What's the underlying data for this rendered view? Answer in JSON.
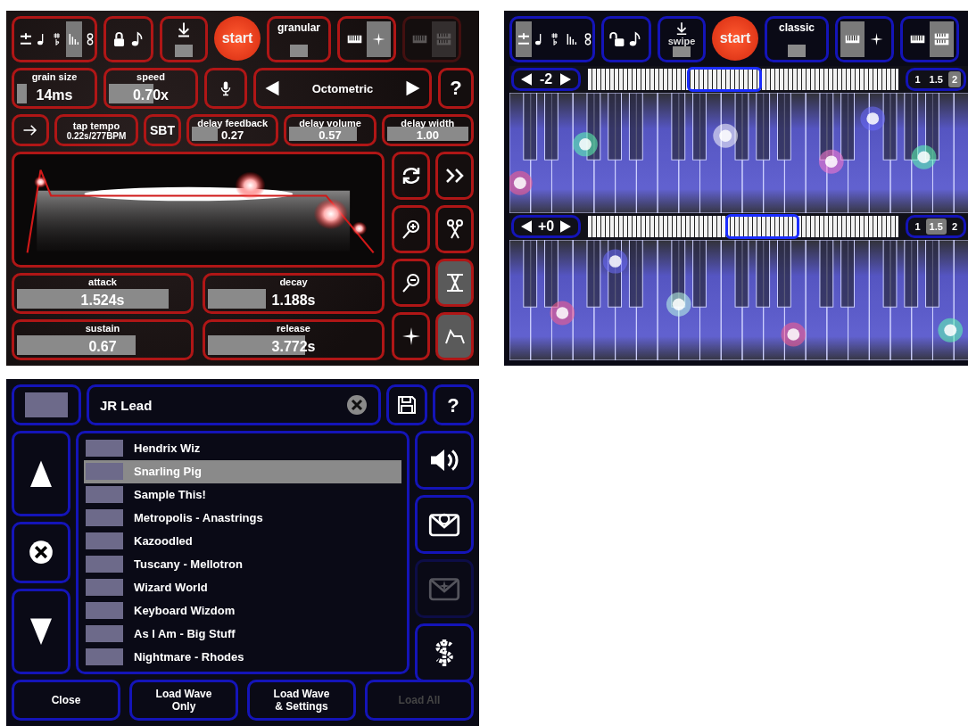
{
  "synth_panel": {
    "toolbar": {
      "tuning_tools": [
        {
          "selected": false
        },
        {
          "selected": false
        },
        {
          "selected": false
        },
        {
          "selected": true
        },
        {
          "selected": false
        }
      ],
      "locked": true,
      "swipe": {
        "on": true
      },
      "start": "start",
      "mode": {
        "label": "granular",
        "on": true
      },
      "views": [
        {
          "selected": false
        },
        {
          "selected": true
        }
      ],
      "layouts": [
        {
          "selected": false
        },
        {
          "selected": true
        }
      ],
      "layout_disabled": true
    },
    "top_sliders": [
      {
        "label": "grain size",
        "value": "14ms",
        "level": 0.12
      },
      {
        "label": "speed",
        "value": "0.70x",
        "level": 0.5
      }
    ],
    "scale": "Octometric",
    "help": "?",
    "tap_tempo": {
      "label": "tap tempo",
      "value": "0.22s/277BPM"
    },
    "sbt": "SBT",
    "delay_sliders": [
      {
        "label": "delay feedback",
        "value": "0.27",
        "level": 0.3
      },
      {
        "label": "delay volume",
        "value": "0.57",
        "level": 0.78
      },
      {
        "label": "delay width",
        "value": "1.00",
        "level": 1
      }
    ],
    "envelope_sliders": [
      {
        "label": "attack",
        "value": "1.524s",
        "level": 0.86
      },
      {
        "label": "decay",
        "value": "1.188s",
        "level": 0.33
      },
      {
        "label": "sustain",
        "value": "0.67",
        "level": 0.67
      },
      {
        "label": "release",
        "value": "3.772s",
        "level": 0.55
      }
    ],
    "side_tools": [
      {
        "selected": false
      },
      {
        "selected": false
      },
      {
        "selected": false
      },
      {
        "selected": false
      },
      {
        "selected": false
      },
      {
        "selected": true
      },
      {
        "selected": false
      },
      {
        "selected": true
      }
    ]
  },
  "keyboard_panel": {
    "toolbar": {
      "tuning_tools": [
        {
          "selected": true
        },
        {
          "selected": false
        },
        {
          "selected": false
        },
        {
          "selected": false
        },
        {
          "selected": false
        }
      ],
      "locked": false,
      "swipe": {
        "label": "swipe",
        "on": true
      },
      "start": "start",
      "mode": {
        "label": "classic",
        "on": true
      },
      "views": [
        {
          "selected": true
        },
        {
          "selected": false
        }
      ],
      "layouts": [
        {
          "selected": false
        },
        {
          "selected": true
        }
      ],
      "layout_disabled": false
    },
    "keyboards": [
      {
        "octave": "-2",
        "level": 0.42,
        "zooms": [
          {
            "label": "1",
            "selected": false
          },
          {
            "label": "1.5",
            "selected": false
          },
          {
            "label": "2",
            "selected": true
          }
        ]
      },
      {
        "octave": "+0",
        "level": 0.58,
        "zooms": [
          {
            "label": "1",
            "selected": false
          },
          {
            "label": "1.5",
            "selected": true
          },
          {
            "label": "2",
            "selected": false
          }
        ]
      }
    ]
  },
  "preset_panel": {
    "preset_name": "JR Lead",
    "help": "?",
    "presets": [
      {
        "name": "Hendrix Wiz",
        "selected": false
      },
      {
        "name": "Snarling Pig",
        "selected": true
      },
      {
        "name": "Sample This!",
        "selected": false
      },
      {
        "name": "Metropolis - Anastrings",
        "selected": false
      },
      {
        "name": "Kazoodled",
        "selected": false
      },
      {
        "name": "Tuscany - Mellotron",
        "selected": false
      },
      {
        "name": "Wizard World",
        "selected": false
      },
      {
        "name": "Keyboard Wizdom",
        "selected": false
      },
      {
        "name": "As I Am - Big Stuff",
        "selected": false
      },
      {
        "name": "Nightmare - Rhodes",
        "selected": false
      }
    ],
    "side_actions": [
      {
        "disabled": false
      },
      {
        "disabled": false
      },
      {
        "disabled": true
      },
      {
        "disabled": false
      }
    ],
    "buttons": [
      {
        "label": "Close",
        "disabled": false
      },
      {
        "label": "Load Wave Only",
        "disabled": false
      },
      {
        "label": "Load Wave & Settings",
        "disabled": false
      },
      {
        "label": "Load All",
        "disabled": true
      }
    ]
  }
}
